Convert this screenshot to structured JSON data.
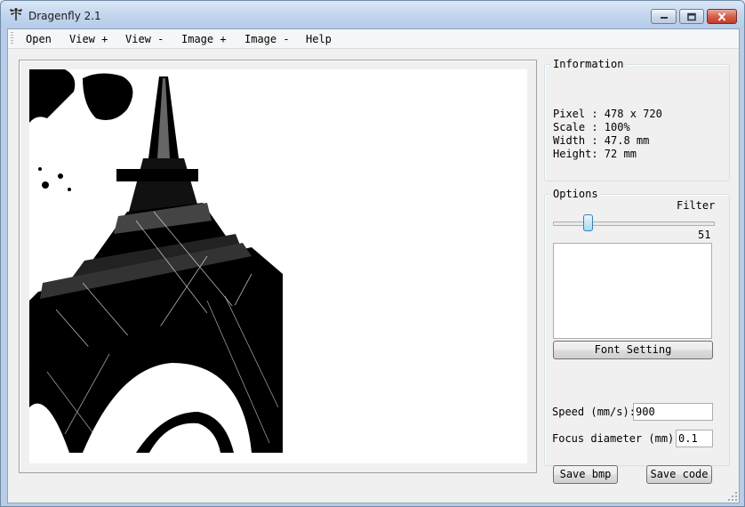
{
  "window": {
    "title": "Dragenfly 2.1",
    "icon": "dragonfly-icon"
  },
  "menu": {
    "items": [
      "Open",
      "View +",
      "View -",
      "Image +",
      "Image -",
      "Help"
    ]
  },
  "information": {
    "title": "Information",
    "lines": [
      "Pixel : 478 x 720",
      "Scale : 100%",
      "Width : 47.8 mm",
      "Height: 72 mm"
    ]
  },
  "options": {
    "title": "Options",
    "filter_label": "Filter",
    "filter_value": "51",
    "filter_fraction": 0.2,
    "text_area_value": "",
    "font_button": "Font Setting",
    "speed_label": "Speed (mm/s):",
    "speed_value": "900",
    "focus_label": "Focus diameter (mm)",
    "focus_value": "0.1",
    "save_bmp_button": "Save bmp",
    "save_code_button": "Save code"
  },
  "colors": {
    "accent": "#3c7fb1",
    "window_border": "#6f8aa8",
    "close_button": "#c13c2b"
  }
}
